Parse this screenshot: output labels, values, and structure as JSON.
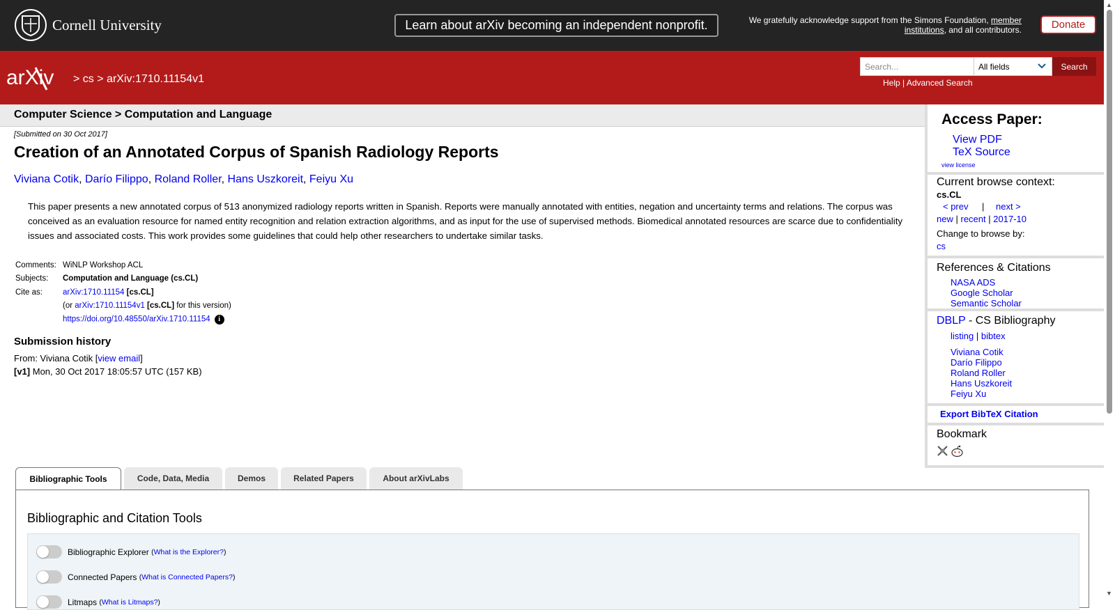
{
  "banner": {
    "org": "Cornell University",
    "announcement": "Learn about arXiv becoming an independent nonprofit.",
    "support_prefix": "We gratefully acknowledge support from the Simons Foundation, ",
    "support_link": "member institutions",
    "support_suffix": ", and all contributors.",
    "donate": "Donate"
  },
  "header": {
    "logo": "arXiv",
    "crumb_sep": ">",
    "crumb_cs": "cs",
    "crumb_id": "arXiv:1710.11154v1",
    "search_placeholder": "Search...",
    "search_field": "All fields",
    "search_button": "Search",
    "help": "Help",
    "help_sep": " | ",
    "advanced": "Advanced Search"
  },
  "paper": {
    "subject_bar": "Computer Science > Computation and Language",
    "submitted": "[Submitted on 30 Oct 2017]",
    "title": "Creation of an Annotated Corpus of Spanish Radiology Reports",
    "authors": [
      "Viviana Cotik",
      "Darío Filippo",
      "Roland Roller",
      "Hans Uszkoreit",
      "Feiyu Xu"
    ],
    "abstract": "This paper presents a new annotated corpus of 513 anonymized radiology reports written in Spanish. Reports were manually annotated with entities, negation and uncertainty terms and relations. The corpus was conceived as an evaluation resource for named entity recognition and relation extraction algorithms, and as input for the use of supervised methods. Biomedical annotated resources are scarce due to confidentiality issues and associated costs. This work provides some guidelines that could help other researchers to undertake similar tasks.",
    "comments_label": "Comments:",
    "comments": "WiNLP Workshop ACL",
    "subjects_label": "Subjects:",
    "subjects": "Computation and Language (cs.CL)",
    "cite_label": "Cite as:",
    "cite_id": "arXiv:1710.11154",
    "cite_cat": "[cs.CL]",
    "cite_or_prefix": "(or ",
    "cite_version_id": "arXiv:1710.11154v1",
    "cite_version_cat": "[cs.CL]",
    "cite_version_suffix": " for this version)",
    "doi": "https://doi.org/10.48550/arXiv.1710.11154"
  },
  "history": {
    "title": "Submission history",
    "from_prefix": "From: Viviana Cotik [",
    "view_email": "view email",
    "from_suffix": "]",
    "v1_label": "[v1]",
    "v1_text": " Mon, 30 Oct 2017 18:05:57 UTC (157 KB)"
  },
  "sidebar": {
    "access_title": "Access Paper:",
    "view_pdf": "View PDF",
    "tex_source": "TeX Source",
    "view_license": "view license",
    "browse_context": "Current browse context:",
    "context_value": "cs.CL",
    "prev": "< prev",
    "pipe": "|",
    "next": "next >",
    "new": "new",
    "recent": "recent",
    "month": "2017-10",
    "change_browse": "Change to browse by:",
    "browse_cs": "cs",
    "refs_title": "References & Citations",
    "nasa": "NASA ADS",
    "google": "Google Scholar",
    "semantic": "Semantic Scholar",
    "dblp": "DBLP",
    "dblp_suffix": " - CS Bibliography",
    "listing": "listing",
    "bibtex": "bibtex",
    "dblp_authors": [
      "Viviana Cotik",
      "Darío Filippo",
      "Roland Roller",
      "Hans Uszkoreit",
      "Feiyu Xu"
    ],
    "export_bibtex": "Export BibTeX Citation",
    "bookmark": "Bookmark"
  },
  "tabs": [
    "Bibliographic Tools",
    "Code, Data, Media",
    "Demos",
    "Related Papers",
    "About arXivLabs"
  ],
  "panel": {
    "title": "Bibliographic and Citation Tools",
    "toggles": [
      {
        "label": "Bibliographic Explorer",
        "help": "What is the Explorer?"
      },
      {
        "label": "Connected Papers",
        "help": "What is Connected Papers?"
      },
      {
        "label": "Litmaps",
        "help": "What is Litmaps?"
      }
    ]
  },
  "colors": {
    "arxiv_red": "#b31b1b",
    "banner_black": "#242424",
    "link": "#0000ee"
  }
}
